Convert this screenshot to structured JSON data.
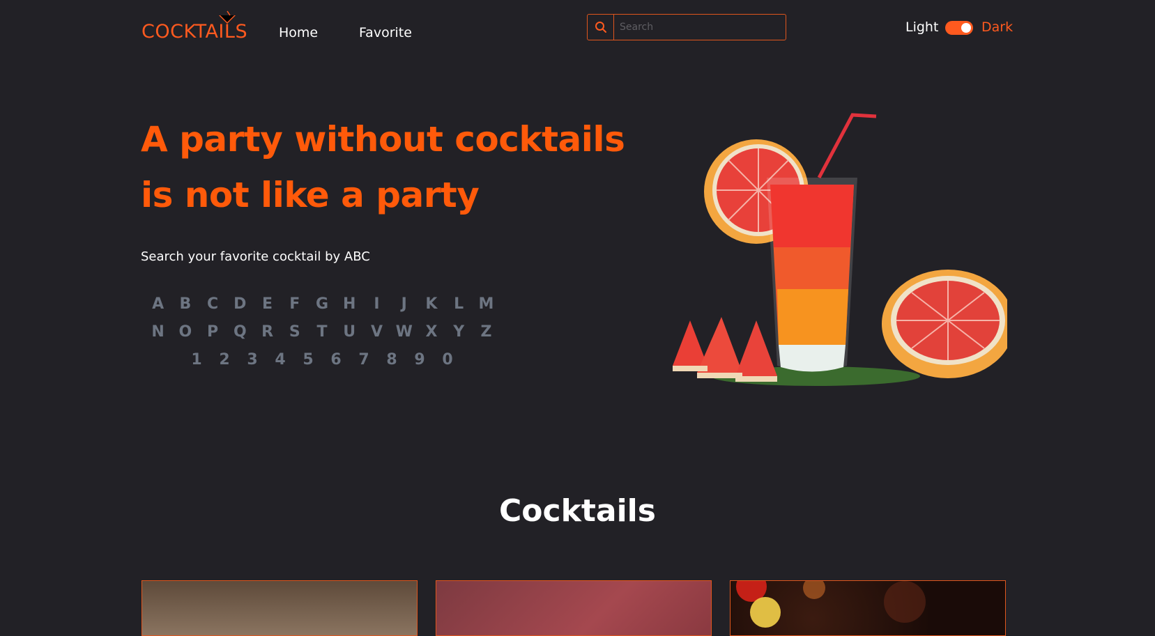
{
  "header": {
    "logo": "COCKTAILS",
    "nav": [
      {
        "label": "Home"
      },
      {
        "label": "Favorite"
      }
    ],
    "search": {
      "placeholder": "Search",
      "value": ""
    },
    "theme": {
      "light_label": "Light",
      "dark_label": "Dark",
      "dark_enabled": true
    }
  },
  "hero": {
    "title_line1": "A party without cocktails",
    "title_line2": "is not like a party",
    "subtitle": "Search your favorite cocktail by ABC",
    "letters_row1": [
      "A",
      "B",
      "C",
      "D",
      "E",
      "F",
      "G",
      "H",
      "I",
      "J",
      "K",
      "L",
      "M"
    ],
    "letters_row2": [
      "N",
      "O",
      "P",
      "Q",
      "R",
      "S",
      "T",
      "U",
      "V",
      "W",
      "X",
      "Y",
      "Z"
    ],
    "digits": [
      "1",
      "2",
      "3",
      "4",
      "5",
      "6",
      "7",
      "8",
      "9",
      "0"
    ]
  },
  "section": {
    "title": "Cocktails"
  },
  "colors": {
    "accent": "#ff5a1f",
    "background": "#222126",
    "letters": "#6d7582"
  }
}
